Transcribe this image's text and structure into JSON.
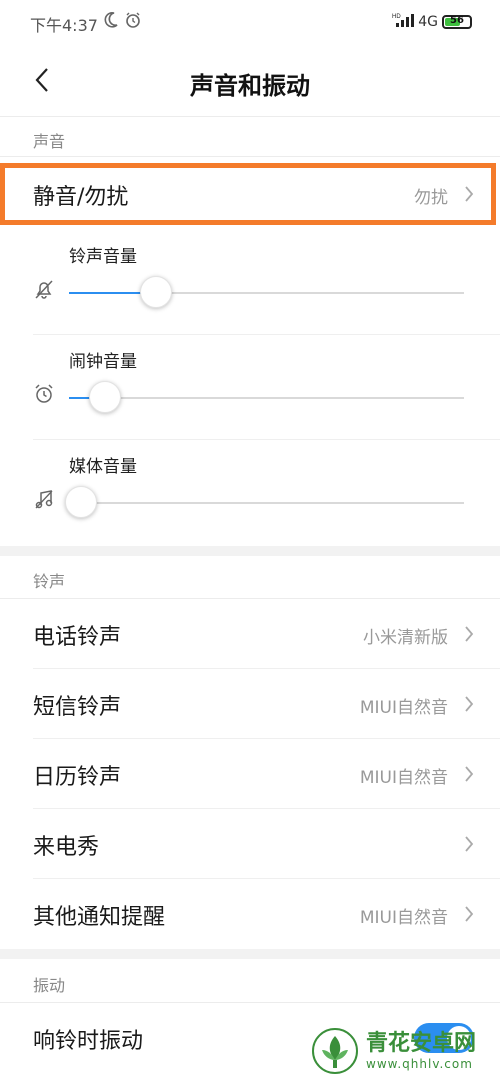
{
  "status_bar": {
    "time": "下午4:37",
    "network": "4G",
    "hd": "HD",
    "battery": "56"
  },
  "header": {
    "title": "声音和振动"
  },
  "sections": {
    "sound": "声音",
    "ringtone": "铃声",
    "vibration": "振动"
  },
  "silent_row": {
    "label": "静音/勿扰",
    "value": "勿扰"
  },
  "volumes": [
    {
      "label": "铃声音量",
      "level": 0.22,
      "icon": "bell-muted-icon"
    },
    {
      "label": "闹钟音量",
      "level": 0.09,
      "icon": "alarm-clock-icon"
    },
    {
      "label": "媒体音量",
      "level": 0.0,
      "icon": "music-note-muted-icon"
    }
  ],
  "ringtone_rows": [
    {
      "label": "电话铃声",
      "value": "小米清新版"
    },
    {
      "label": "短信铃声",
      "value": "MIUI自然音"
    },
    {
      "label": "日历铃声",
      "value": "MIUI自然音"
    },
    {
      "label": "来电秀",
      "value": ""
    },
    {
      "label": "其他通知提醒",
      "value": "MIUI自然音"
    }
  ],
  "vibration_rows": [
    {
      "label": "响铃时振动",
      "enabled": true
    }
  ],
  "watermark": {
    "title": "青花安卓网",
    "url": "www.qhhlv.com"
  },
  "colors": {
    "accent": "#2b8ef0",
    "highlight": "#f47b2b"
  }
}
